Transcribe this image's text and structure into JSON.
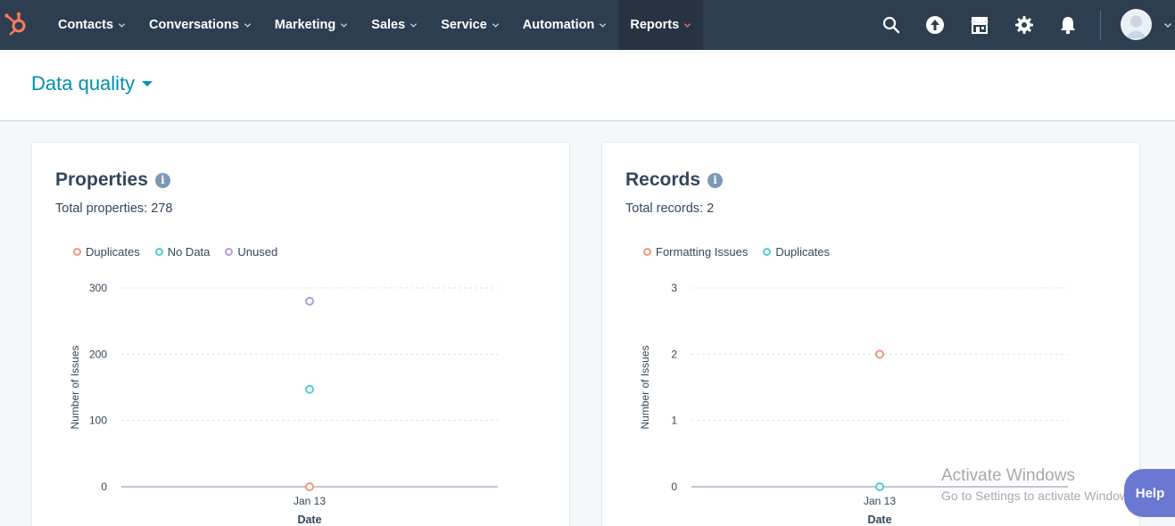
{
  "nav": {
    "items": [
      {
        "label": "Contacts"
      },
      {
        "label": "Conversations"
      },
      {
        "label": "Marketing"
      },
      {
        "label": "Sales"
      },
      {
        "label": "Service"
      },
      {
        "label": "Automation"
      },
      {
        "label": "Reports"
      }
    ],
    "active_item": "Reports",
    "icons": [
      "search-icon",
      "upgrade-icon",
      "marketplace-icon",
      "settings-icon",
      "notifications-icon"
    ]
  },
  "header": {
    "title": "Data quality"
  },
  "properties_card": {
    "title": "Properties",
    "total": "Total properties: 278"
  },
  "records_card": {
    "title": "Records",
    "total": "Total records: 2"
  },
  "chart_data": [
    {
      "type": "scatter",
      "title": "",
      "xlabel": "Date",
      "ylabel": "Number of Issues",
      "x": [
        "Jan 13"
      ],
      "yticks": [
        0,
        100,
        200,
        300
      ],
      "ylim": [
        0,
        300
      ],
      "legend_position": "top-left",
      "grid": true,
      "series": [
        {
          "name": "Duplicates",
          "color": "#f2977e",
          "values": [
            0
          ]
        },
        {
          "name": "No Data",
          "color": "#4fcfcb",
          "values": [
            147
          ]
        },
        {
          "name": "Unused",
          "color": "#b59ede",
          "values": [
            280
          ]
        }
      ]
    },
    {
      "type": "scatter",
      "title": "",
      "xlabel": "Date",
      "ylabel": "Number of Issues",
      "x": [
        "Jan 13"
      ],
      "yticks": [
        0,
        1,
        2,
        3
      ],
      "ylim": [
        0,
        3
      ],
      "legend_position": "top-left",
      "grid": true,
      "series": [
        {
          "name": "Formatting Issues",
          "color": "#f2977e",
          "values": [
            2
          ]
        },
        {
          "name": "Duplicates",
          "color": "#4fcfcb",
          "values": [
            0
          ]
        }
      ]
    }
  ],
  "watermark": {
    "line1": "Activate Windows",
    "line2": "Go to Settings to activate Windows."
  },
  "help": {
    "label": "Help"
  }
}
